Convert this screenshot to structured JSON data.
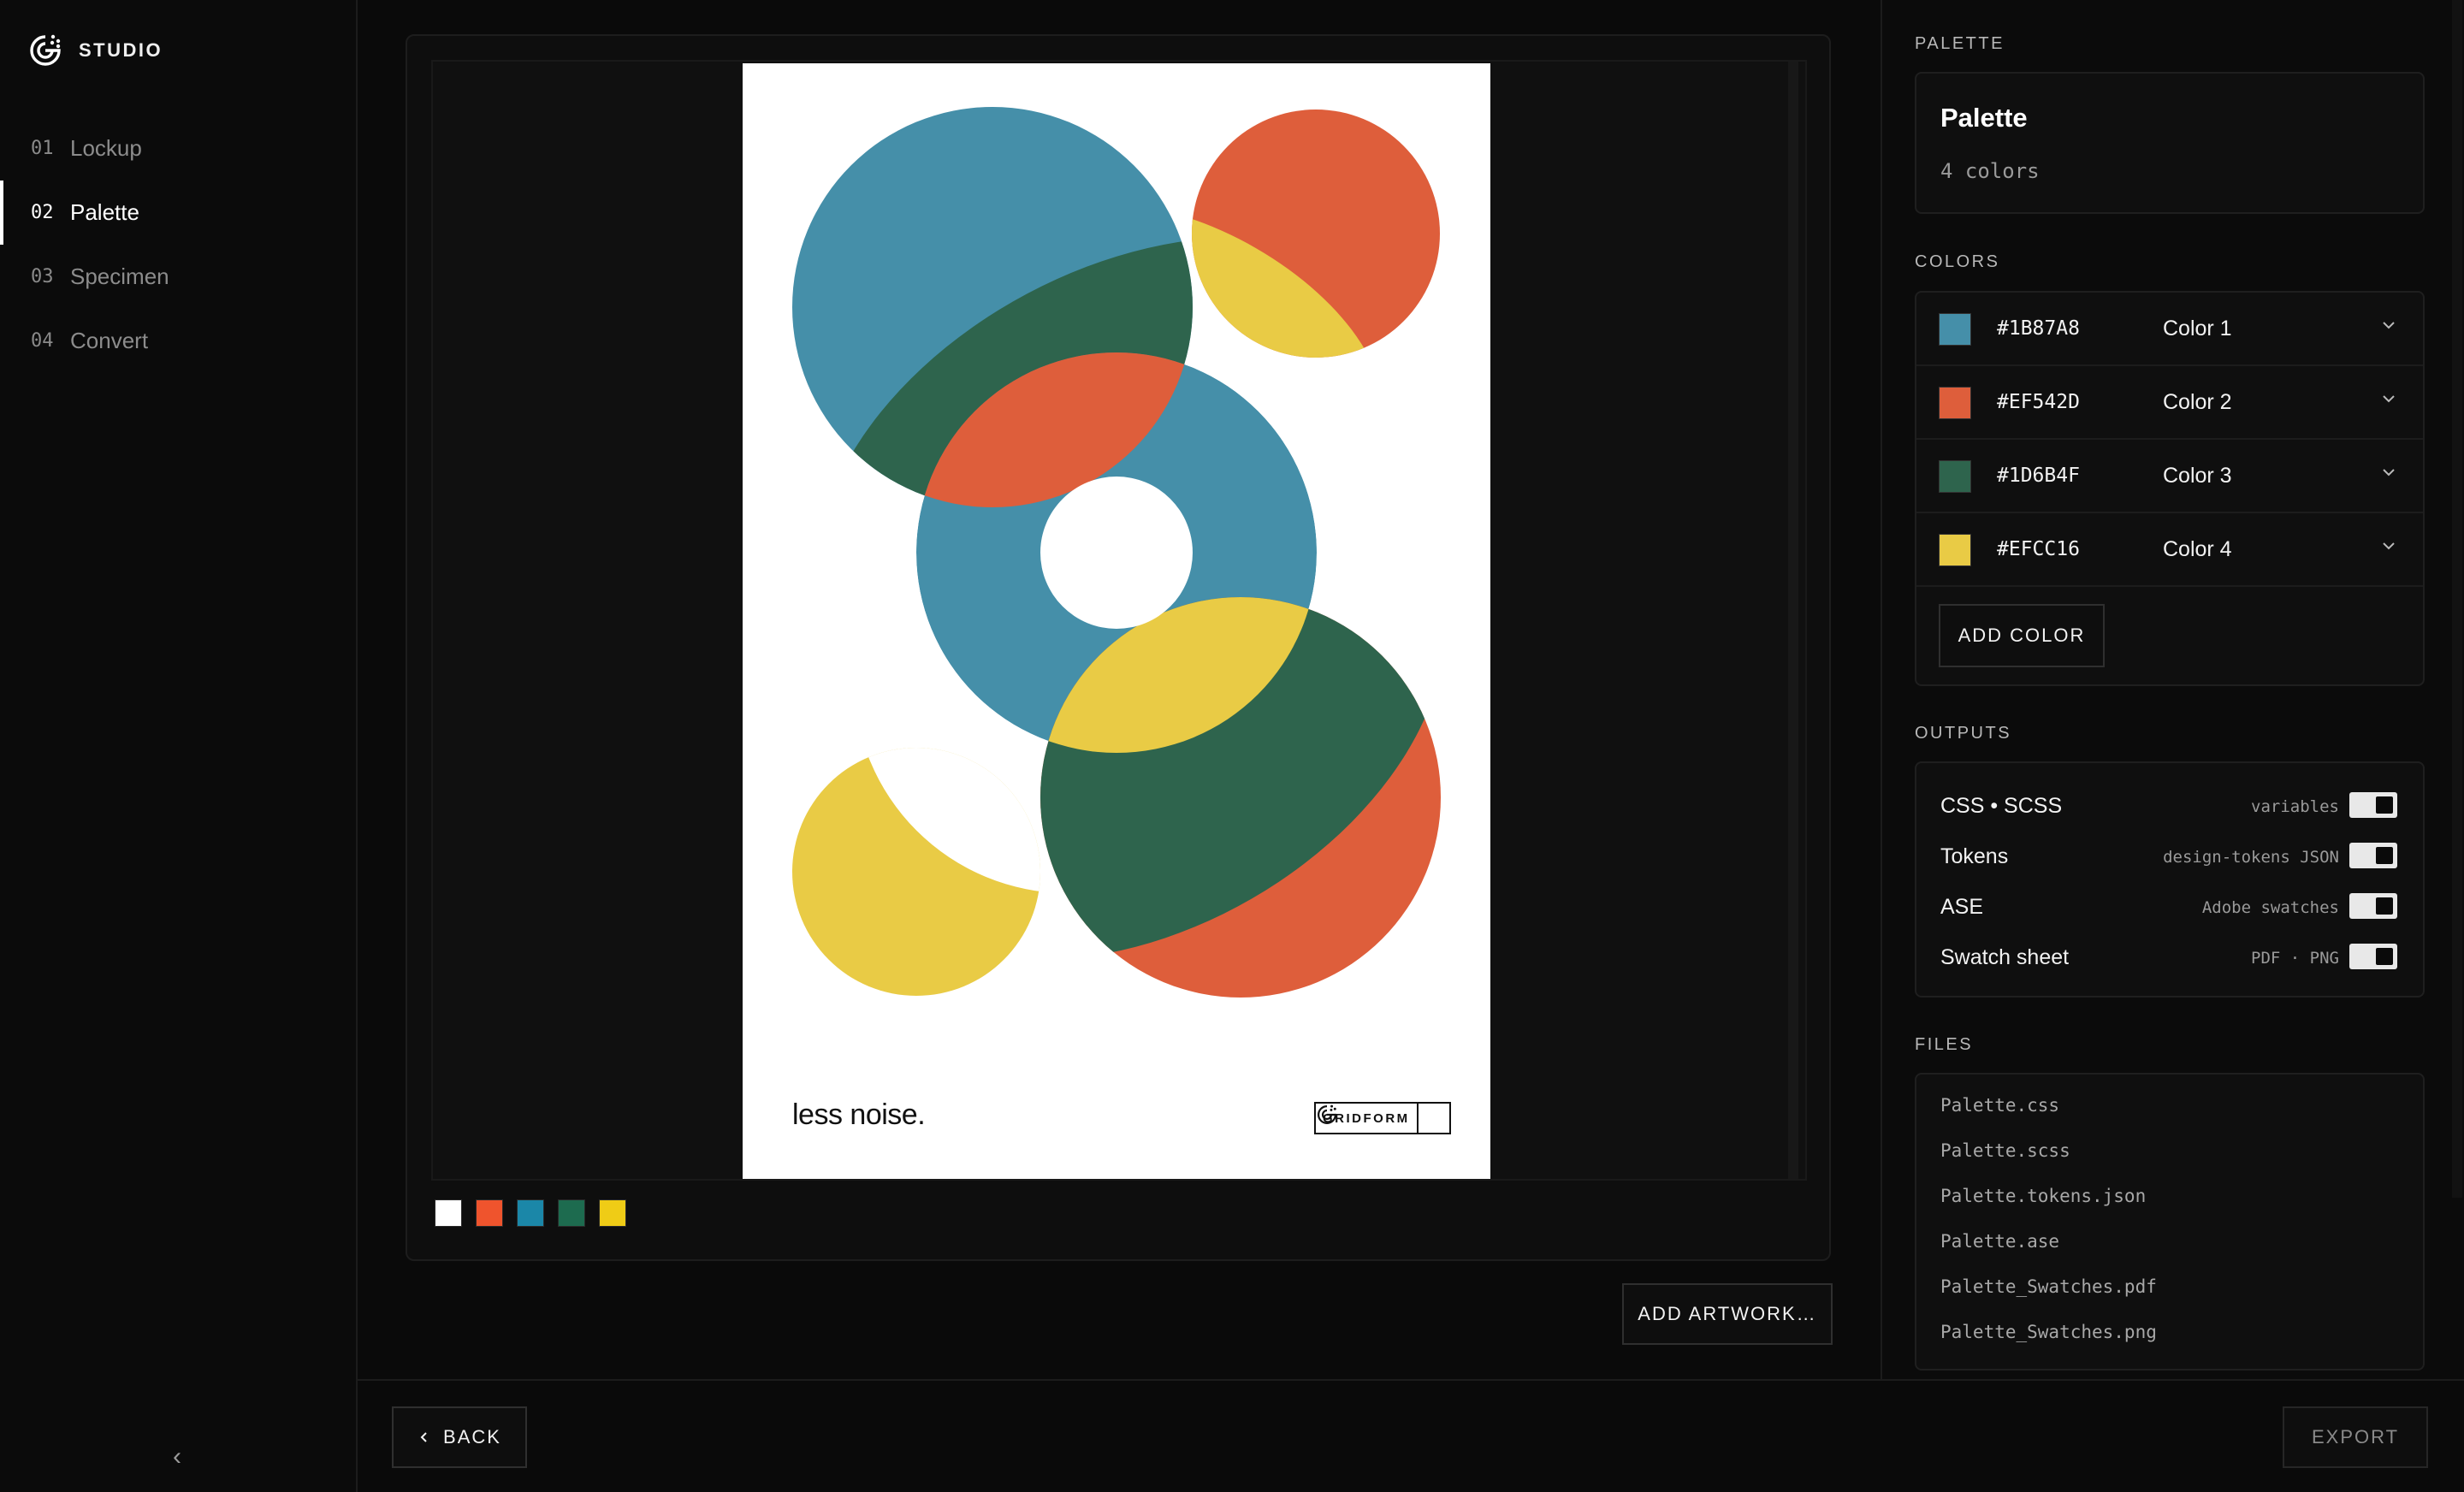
{
  "brand": {
    "name": "STUDIO",
    "logo_icon": "studio-g-logo-icon"
  },
  "nav": [
    {
      "num": "01",
      "label": "Lockup",
      "active": false
    },
    {
      "num": "02",
      "label": "Palette",
      "active": true
    },
    {
      "num": "03",
      "label": "Specimen",
      "active": false
    },
    {
      "num": "04",
      "label": "Convert",
      "active": false
    }
  ],
  "sidebar": {
    "collapse_icon": "chevron-left-icon",
    "collapse_glyph": "‹"
  },
  "artwork": {
    "tagline": "less noise.",
    "mark": "GRIDFORM",
    "swatch_colors": [
      "#FFFFFF",
      "#EF542D",
      "#1B87A8",
      "#1D6B4F",
      "#EFCC16"
    ]
  },
  "actions": {
    "add_artwork": "ADD ARTWORK…",
    "back": "BACK",
    "back_icon": "chevron-left-icon",
    "export": "EXPORT"
  },
  "panel": {
    "palette_section": "PALETTE",
    "palette_title": "Palette",
    "palette_count": "4 colors",
    "colors_section": "COLORS",
    "colors": [
      {
        "hex": "#1B87A8",
        "name": "Color 1",
        "swatch": "#458FA9"
      },
      {
        "hex": "#EF542D",
        "name": "Color 2",
        "swatch": "#DE5E3B"
      },
      {
        "hex": "#1D6B4F",
        "name": "Color 3",
        "swatch": "#2E644D"
      },
      {
        "hex": "#EFCC16",
        "name": "Color 4",
        "swatch": "#E9CB45"
      }
    ],
    "add_color": "ADD COLOR",
    "outputs_section": "OUTPUTS",
    "outputs": [
      {
        "name": "CSS • SCSS",
        "desc": "variables",
        "enabled": true
      },
      {
        "name": "Tokens",
        "desc": "design-tokens JSON",
        "enabled": true
      },
      {
        "name": "ASE",
        "desc": "Adobe swatches",
        "enabled": true
      },
      {
        "name": "Swatch sheet",
        "desc": "PDF · PNG",
        "enabled": true
      }
    ],
    "files_section": "FILES",
    "files": [
      "Palette.css",
      "Palette.scss",
      "Palette.tokens.json",
      "Palette.ase",
      "Palette_Swatches.pdf",
      "Palette_Swatches.png"
    ]
  }
}
